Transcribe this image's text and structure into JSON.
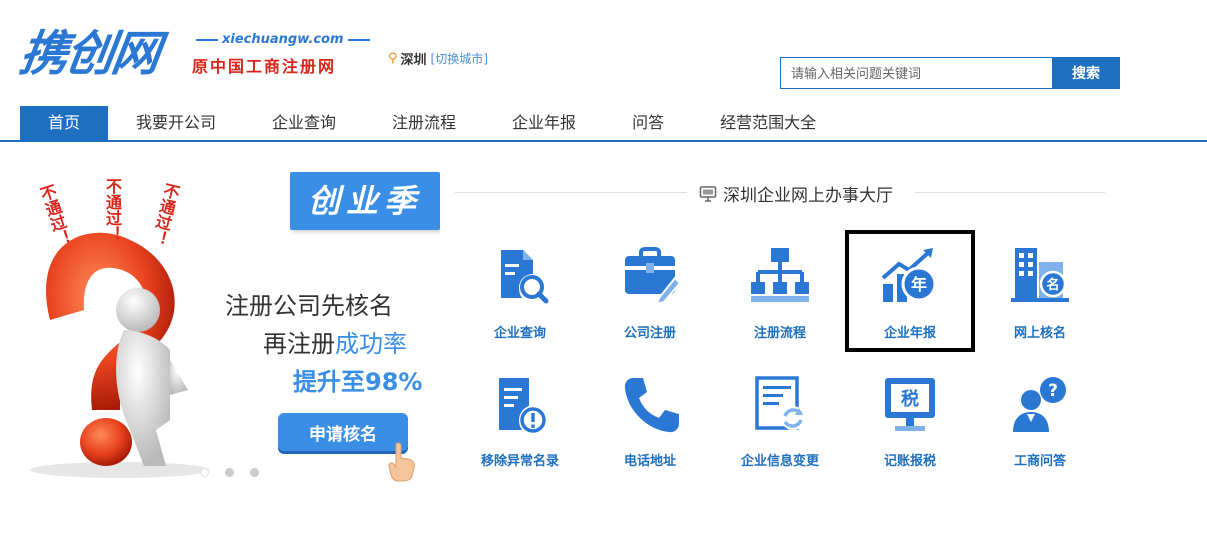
{
  "header": {
    "logo": "携创网",
    "domain": "xiechuangw.com",
    "tagline": "原中国工商注册网",
    "city": "深圳",
    "city_switch": "[切换城市]",
    "search_placeholder": "请输入相关问题关键词",
    "search_button": "搜索"
  },
  "nav": {
    "items": [
      "首页",
      "我要开公司",
      "企业查询",
      "注册流程",
      "企业年报",
      "问答",
      "经营范围大全"
    ],
    "active_index": 0
  },
  "banner": {
    "season": "创业季",
    "bubbles": [
      "不通过！",
      "不通过！",
      "不通过！"
    ],
    "line1": "注册公司先核名",
    "line2_plain": "再注册",
    "line2_highlight": "成功率",
    "line3": "提升至98%",
    "button": "申请核名",
    "slide_count": 3,
    "active_slide": 0
  },
  "hall": {
    "title": "深圳企业网上办事大厅",
    "row1": [
      {
        "label": "企业查询",
        "icon": "document-search-icon"
      },
      {
        "label": "公司注册",
        "icon": "briefcase-pen-icon"
      },
      {
        "label": "注册流程",
        "icon": "org-chart-icon"
      },
      {
        "label": "企业年报",
        "icon": "annual-report-chart-icon"
      },
      {
        "label": "网上核名",
        "icon": "building-name-icon"
      }
    ],
    "row2": [
      {
        "label": "移除异常名录",
        "icon": "document-alert-icon"
      },
      {
        "label": "电话地址",
        "icon": "phone-icon"
      },
      {
        "label": "企业信息变更",
        "icon": "document-refresh-icon"
      },
      {
        "label": "记账报税",
        "icon": "tax-monitor-icon"
      },
      {
        "label": "工商问答",
        "icon": "user-question-icon"
      }
    ],
    "highlighted": "企业年报"
  },
  "colors": {
    "brand_blue": "#1e6fbf",
    "accent_blue": "#3a8ee6",
    "red": "#d8251b",
    "orange": "#f08a1f"
  }
}
